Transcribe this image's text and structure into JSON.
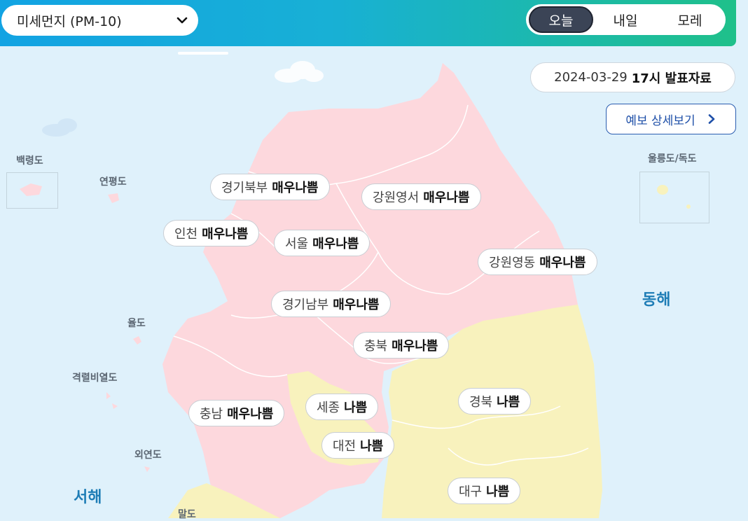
{
  "header": {
    "pollutant": {
      "label": "미세먼지 (PM-10)",
      "icon": "chevron-down-icon"
    },
    "day_tabs": [
      {
        "label": "오늘",
        "active": true
      },
      {
        "label": "내일",
        "active": false
      },
      {
        "label": "모레",
        "active": false
      }
    ]
  },
  "release": {
    "date": "2024-03-29",
    "time_label": "17시 발표자료"
  },
  "detail_button": {
    "label": "예보 상세보기",
    "icon": "chevron-right-icon"
  },
  "legend_colors": {
    "very_bad": "#fdd8dd",
    "bad": "#f8f2bd",
    "sea": "#dff1fb"
  },
  "regions": [
    {
      "name": "경기북부",
      "level": "매우나쁨"
    },
    {
      "name": "강원영서",
      "level": "매우나쁨"
    },
    {
      "name": "인천",
      "level": "매우나쁨"
    },
    {
      "name": "서울",
      "level": "매우나쁨"
    },
    {
      "name": "강원영동",
      "level": "매우나쁨"
    },
    {
      "name": "경기남부",
      "level": "매우나쁨"
    },
    {
      "name": "충북",
      "level": "매우나쁨"
    },
    {
      "name": "경북",
      "level": "나쁨"
    },
    {
      "name": "세종",
      "level": "나쁨"
    },
    {
      "name": "충남",
      "level": "매우나쁨"
    },
    {
      "name": "대전",
      "level": "나쁨"
    },
    {
      "name": "대구",
      "level": "나쁨"
    }
  ],
  "places": {
    "baengnyeong": "백령도",
    "yeonpyeong": "연평도",
    "ulleung_dokdo": "울릉도/독도",
    "yuldo": "율도",
    "gyeokryeol": "격렬비열도",
    "oeyeon": "외연도",
    "maldo": "말도"
  },
  "seas": {
    "east": "동해",
    "west": "서해"
  }
}
